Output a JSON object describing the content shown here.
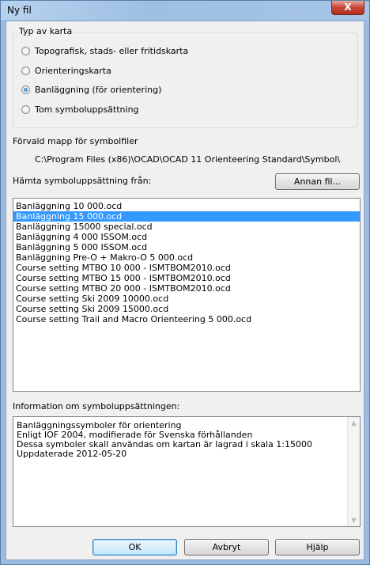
{
  "window": {
    "title": "Ny fil",
    "close_label": "X"
  },
  "map_type": {
    "legend": "Typ av karta",
    "options": [
      {
        "label": "Topografisk, stads- eller fritidskarta",
        "checked": false
      },
      {
        "label": "Orienteringskarta",
        "checked": false
      },
      {
        "label": "Banläggning (för orientering)",
        "checked": true
      },
      {
        "label": "Tom symboluppsättning",
        "checked": false
      }
    ]
  },
  "default_folder": {
    "label": "Förvald mapp för symbolfiler",
    "path": "C:\\Program Files (x86)\\OCAD\\OCAD 11 Orienteering Standard\\Symbol\\"
  },
  "symbol_set": {
    "label": "Hämta symboluppsättning från:",
    "other_file_button": "Annan fil...",
    "items": [
      "Banläggning 10 000.ocd",
      "Banläggning 15 000.ocd",
      "Banläggning 15000 special.ocd",
      "Banläggning 4 000 ISSOM.ocd",
      "Banläggning 5 000 ISSOM.ocd",
      "Banläggning Pre-O + Makro-O 5 000.ocd",
      "Course setting MTBO 10 000 - ISMTBOM2010.ocd",
      "Course setting MTBO 15 000 - ISMTBOM2010.ocd",
      "Course setting MTBO 20 000 - ISMTBOM2010.ocd",
      "Course setting Ski 2009 10000.ocd",
      "Course setting Ski 2009 15000.ocd",
      "Course setting Trail and Macro Orienteering 5 000.ocd"
    ],
    "selected_index": 1
  },
  "info": {
    "label": "Information om symboluppsättningen:",
    "lines": [
      "Banläggningssymboler för orientering",
      "Enligt IOF 2004, modifierade för Svenska förhållanden",
      "Dessa symboler skall användas om kartan är lagrad i skala 1:15000",
      "Uppdaterade 2012-05-20"
    ]
  },
  "buttons": {
    "ok": "OK",
    "cancel": "Avbryt",
    "help": "Hjälp"
  }
}
